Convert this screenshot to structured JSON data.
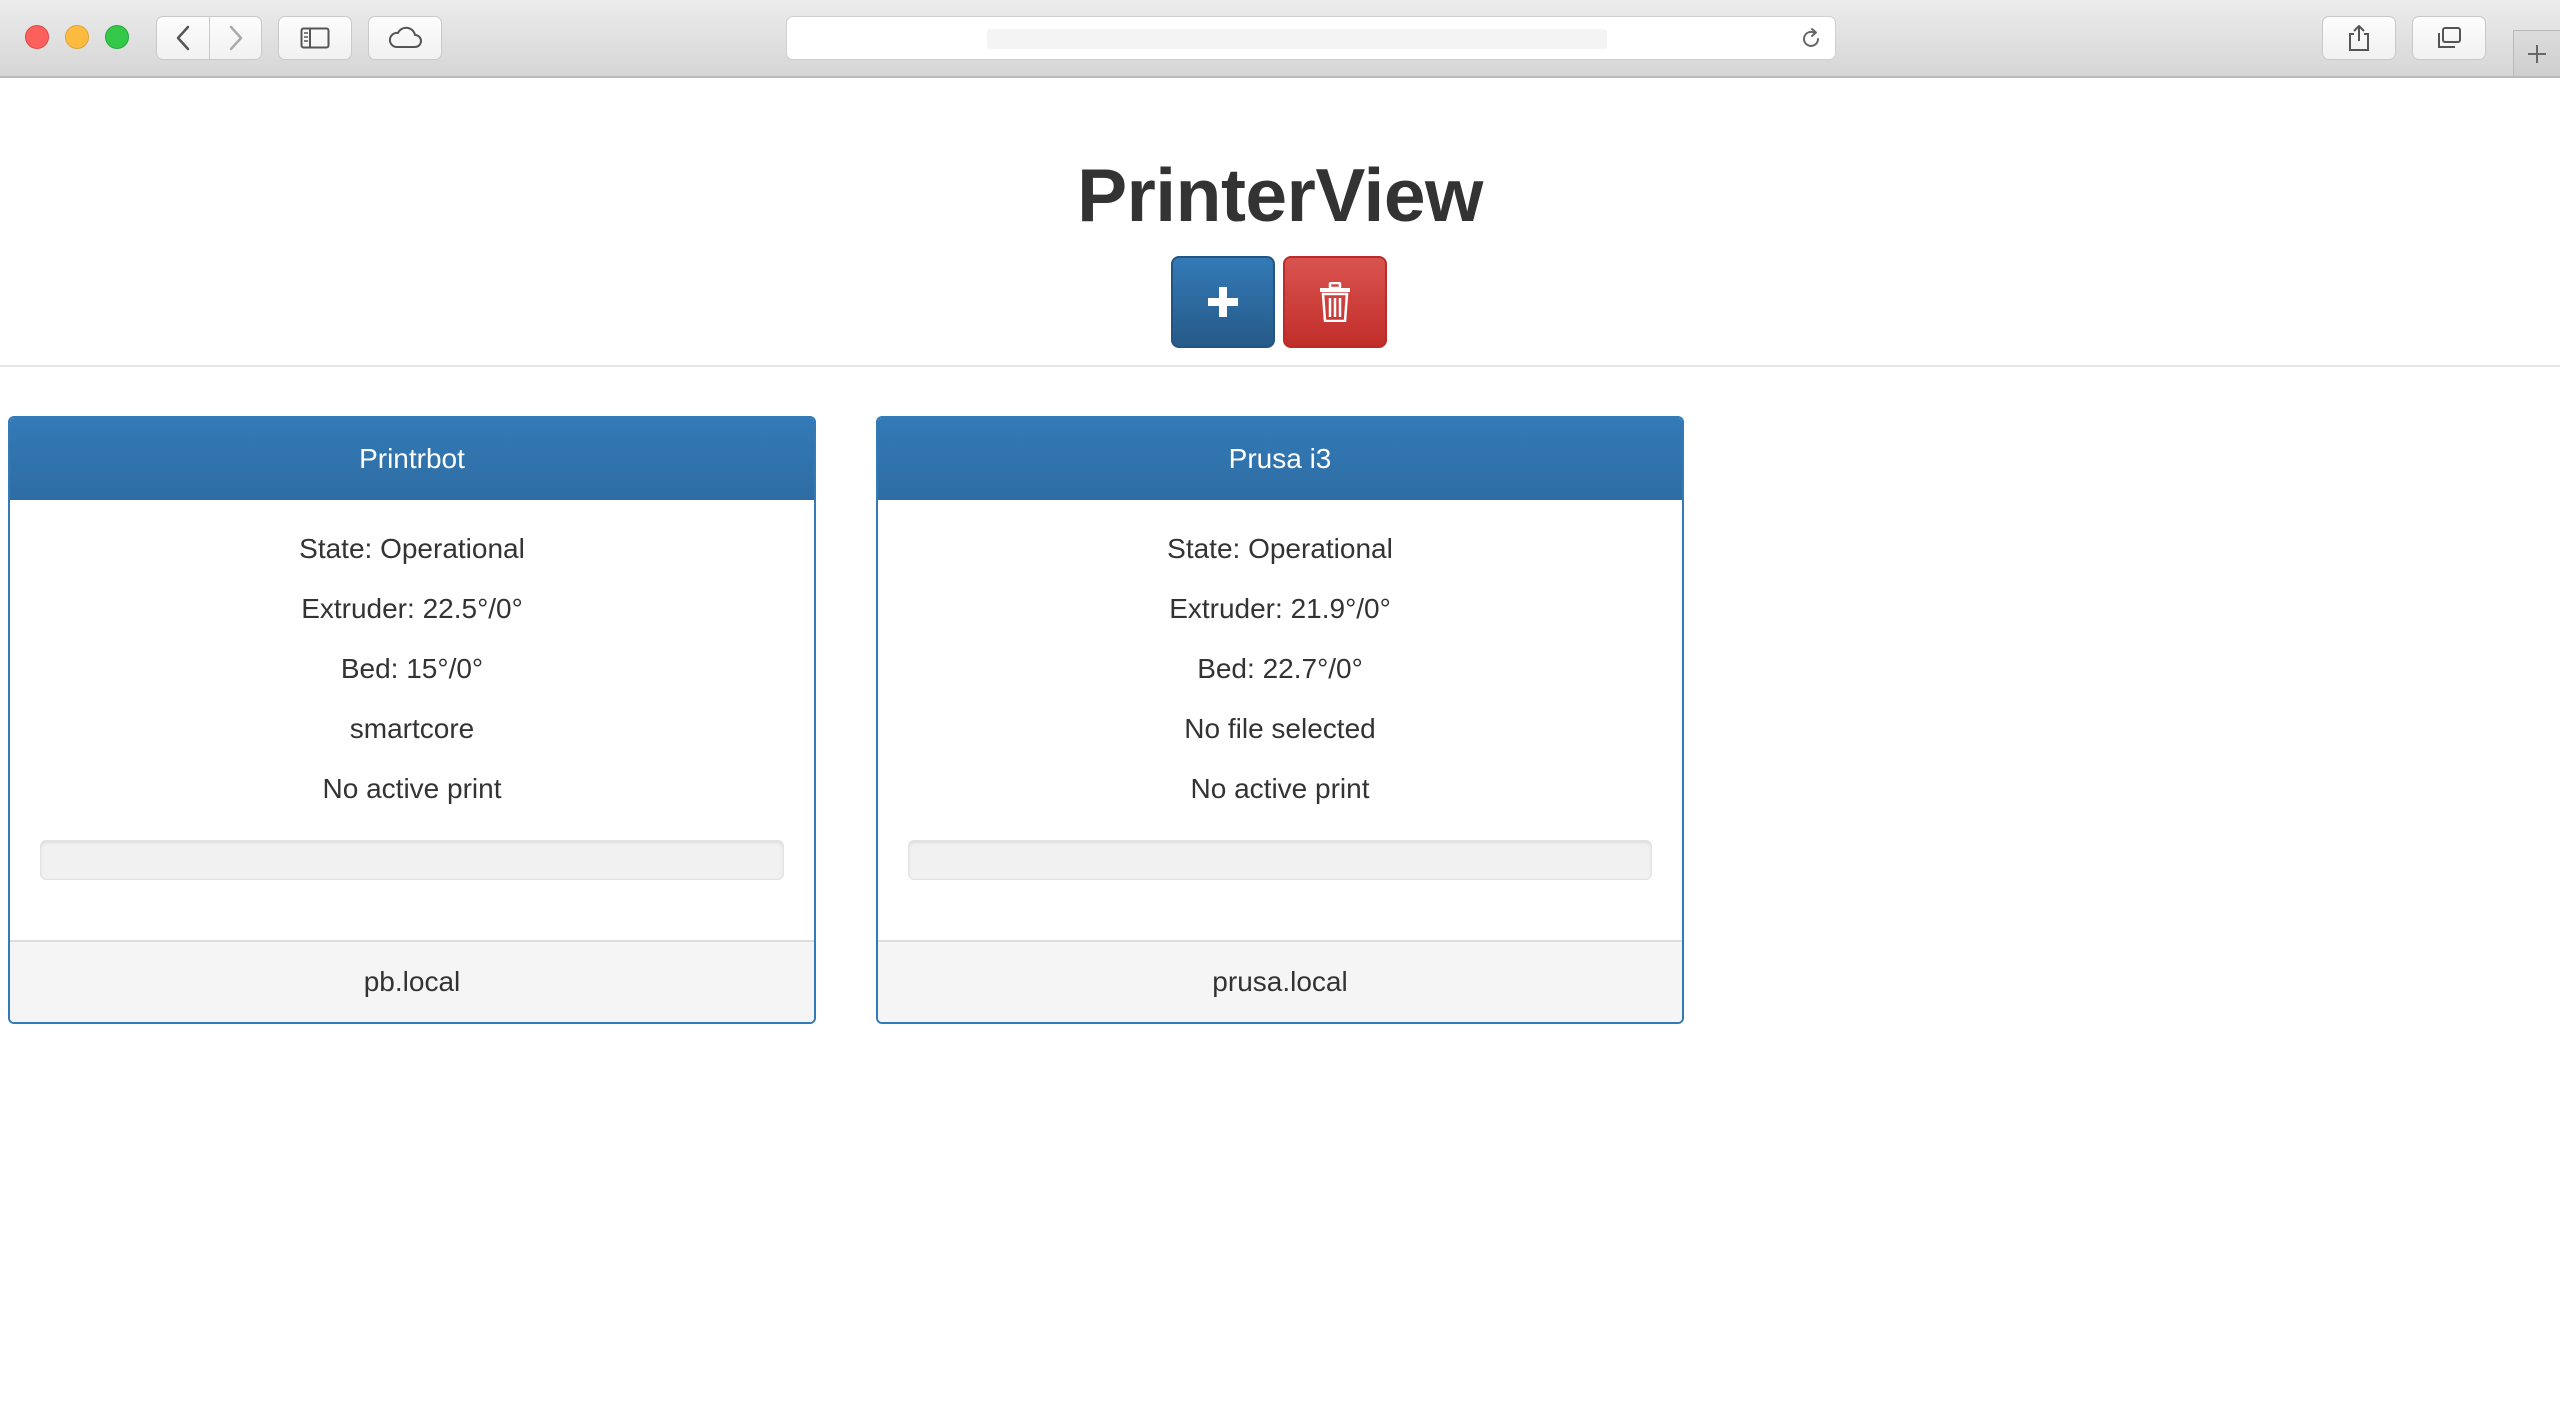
{
  "browser": {
    "url": ""
  },
  "app": {
    "title": "PrinterView"
  },
  "printers": [
    {
      "name": "Printrbot",
      "state": "State: Operational",
      "extruder": "Extruder: 22.5°/0°",
      "bed": "Bed: 15°/0°",
      "file": "smartcore",
      "print_status": "No active print",
      "progress": 0,
      "host": "pb.local"
    },
    {
      "name": "Prusa i3",
      "state": "State: Operational",
      "extruder": "Extruder: 21.9°/0°",
      "bed": "Bed: 22.7°/0°",
      "file": "No file selected",
      "print_status": "No active print",
      "progress": 0,
      "host": "prusa.local"
    }
  ],
  "colors": {
    "primary": "#337ab7",
    "danger": "#d9534f"
  },
  "icons": {
    "add": "plus-icon",
    "delete": "trash-icon"
  }
}
